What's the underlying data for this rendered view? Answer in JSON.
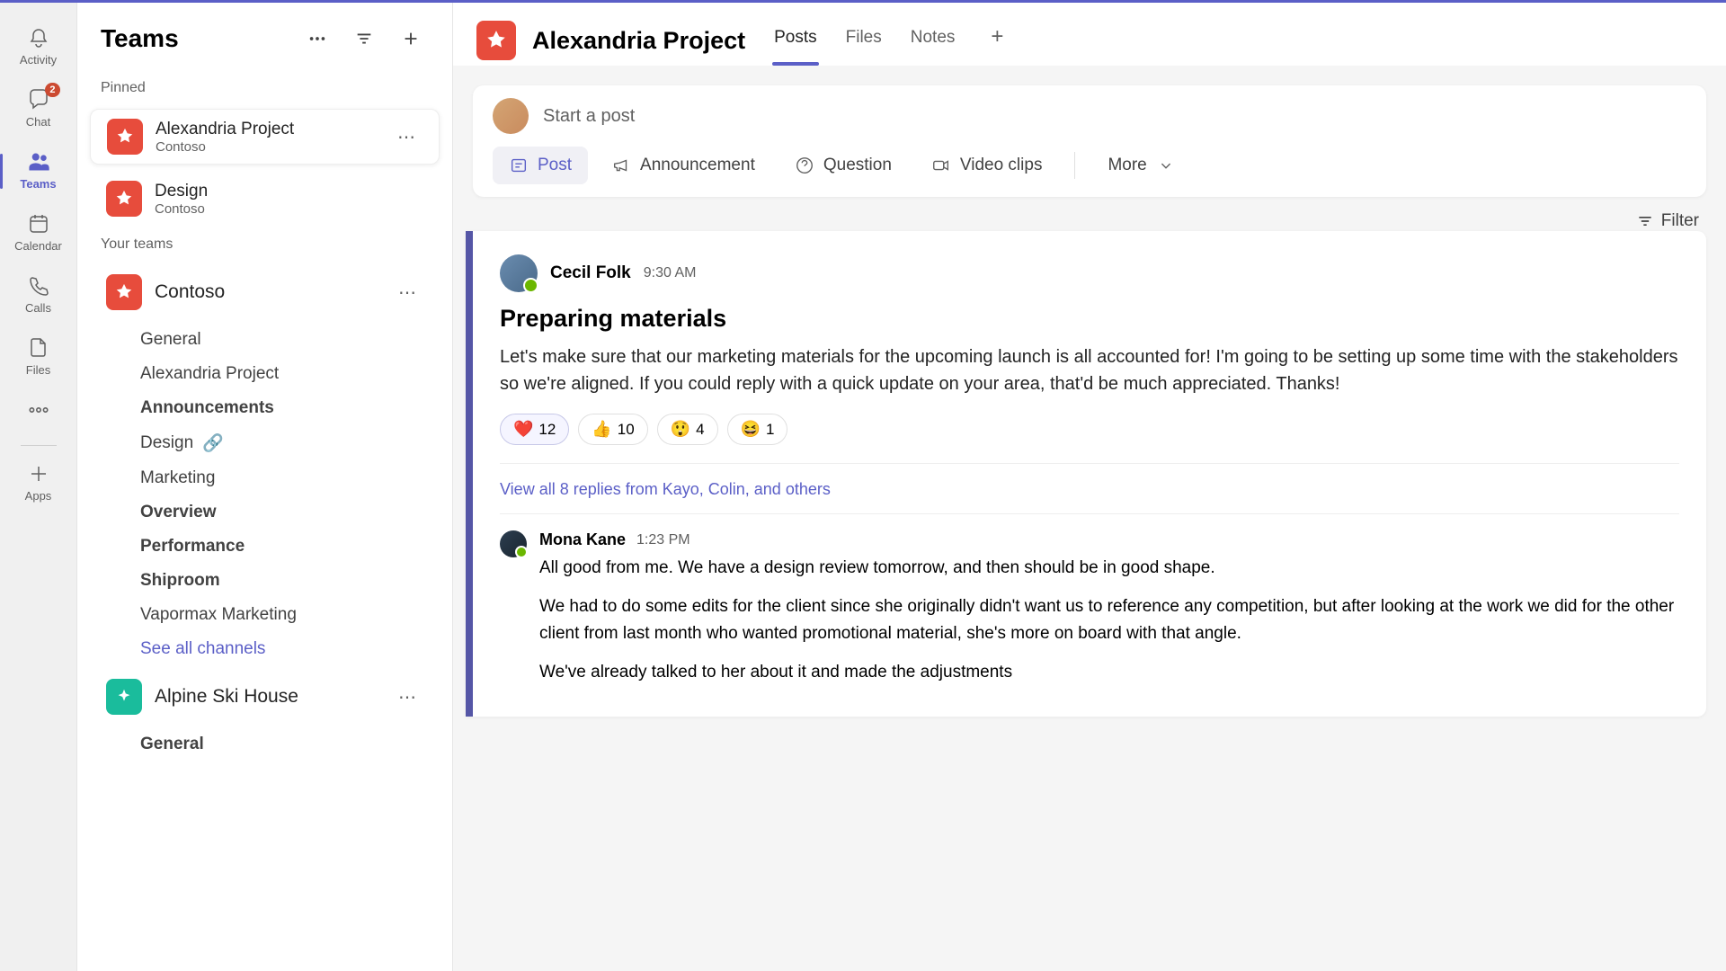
{
  "nav": {
    "activity": "Activity",
    "chat": "Chat",
    "chat_badge": "2",
    "teams": "Teams",
    "calendar": "Calendar",
    "calls": "Calls",
    "files": "Files",
    "apps": "Apps"
  },
  "sidebar": {
    "title": "Teams",
    "pinned_label": "Pinned",
    "pinned": [
      {
        "name": "Alexandria Project",
        "sub": "Contoso"
      },
      {
        "name": "Design",
        "sub": "Contoso"
      }
    ],
    "your_teams_label": "Your teams",
    "teams": [
      {
        "name": "Contoso",
        "channels": [
          {
            "name": "General",
            "bold": false
          },
          {
            "name": "Alexandria Project",
            "bold": false
          },
          {
            "name": "Announcements",
            "bold": true
          },
          {
            "name": "Design",
            "bold": false,
            "link": true
          },
          {
            "name": "Marketing",
            "bold": false
          },
          {
            "name": "Overview",
            "bold": true
          },
          {
            "name": "Performance",
            "bold": true
          },
          {
            "name": "Shiproom",
            "bold": true
          },
          {
            "name": "Vapormax Marketing",
            "bold": false
          }
        ],
        "see_all": "See all channels"
      },
      {
        "name": "Alpine Ski House",
        "channels": [
          {
            "name": "General",
            "bold": true
          }
        ]
      }
    ]
  },
  "channel": {
    "title": "Alexandria Project",
    "tabs": [
      "Posts",
      "Files",
      "Notes"
    ]
  },
  "compose": {
    "placeholder": "Start a post",
    "post": "Post",
    "announcement": "Announcement",
    "question": "Question",
    "video": "Video clips",
    "more": "More"
  },
  "filter": "Filter",
  "post": {
    "author": "Cecil Folk",
    "time": "9:30 AM",
    "title": "Preparing materials",
    "body": "Let's make sure that our marketing materials for the upcoming launch is all accounted for! I'm going to be setting up some time with the stakeholders so we're aligned. If you could reply with a quick update on your area, that'd be much appreciated. Thanks!",
    "reactions": [
      {
        "icon": "❤️",
        "count": "12",
        "mine": true
      },
      {
        "icon": "👍",
        "count": "10"
      },
      {
        "icon": "😲",
        "count": "4"
      },
      {
        "icon": "😆",
        "count": "1"
      }
    ],
    "replies_link": "View all 8 replies from Kayo, Colin, and others",
    "reply": {
      "author": "Mona Kane",
      "time": "1:23 PM",
      "p1": "All good from me. We have a design review tomorrow, and then should be in good shape.",
      "p2": "We had to do some edits for the client since she originally didn't want us to reference any competition, but after looking at the work we did for the other client from last month who wanted promotional material, she's more on board with that angle.",
      "p3": "We've already talked to her about it and made the adjustments"
    }
  }
}
